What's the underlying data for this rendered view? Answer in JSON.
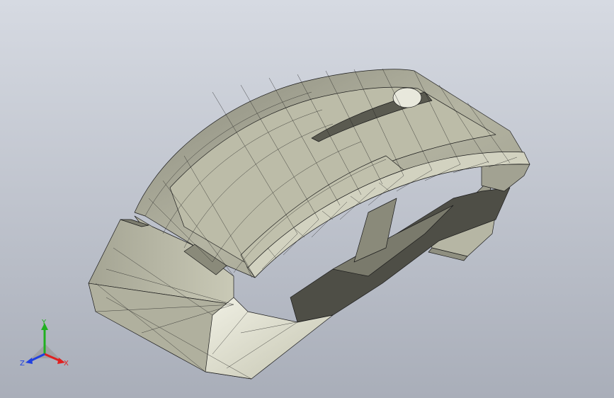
{
  "viewport": {
    "background_top": "#d3d8e0",
    "background_bottom": "#a8adb8",
    "model_name": "",
    "display_mode": "shaded-with-edges",
    "face_color": "#c8c8b4",
    "edge_color": "#1a1a1a"
  },
  "triad": {
    "x_label": "X",
    "y_label": "Y",
    "z_label": "Z",
    "x_color": "#e02020",
    "y_color": "#20b020",
    "z_color": "#2040e0"
  }
}
